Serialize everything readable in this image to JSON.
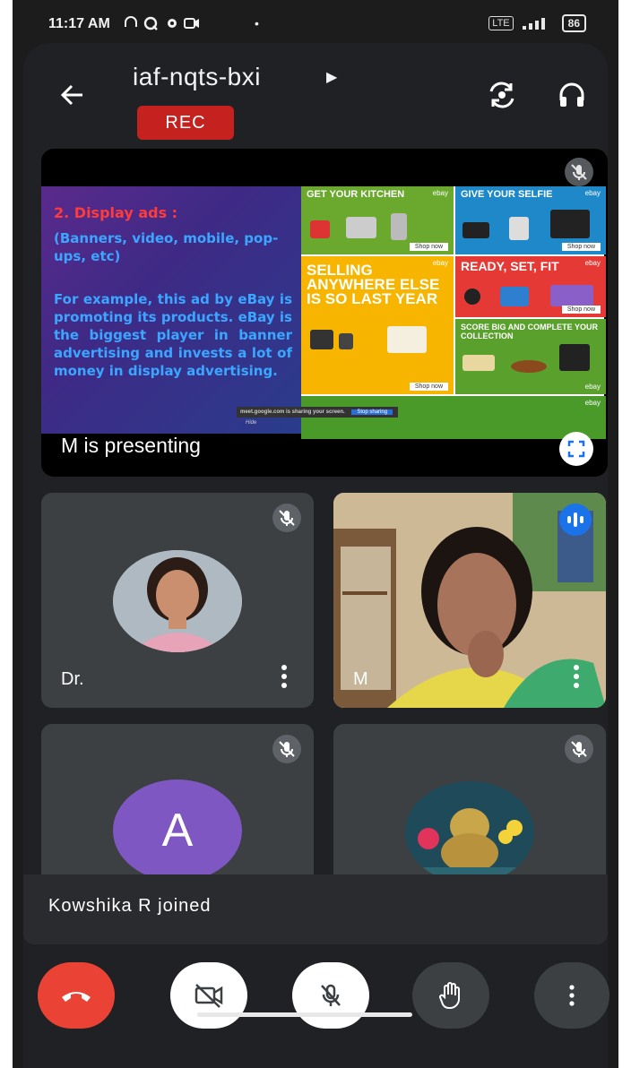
{
  "status_bar": {
    "time": "11:17 AM",
    "network": "LTE",
    "battery": "86"
  },
  "meeting": {
    "code": "iaf-nqts-bxi",
    "rec_label": "REC"
  },
  "presentation": {
    "presenter_label": "M is presenting",
    "slide": {
      "heading": "2. Display ads :",
      "subheading": "(Banners, video, mobile, pop-ups, etc)",
      "body": "For example, this ad by eBay is promoting its products. eBay is the biggest player in banner advertising and invests a lot of money in display advertising.",
      "ads": {
        "kitchen": "GET YOUR KITCHEN",
        "selfie": "GIVE YOUR SELFIE",
        "ready": "READY, SET, FIT",
        "selling": "SELLING ANYWHERE ELSE IS SO LAST YEAR",
        "score": "SCORE BIG AND COMPLETE YOUR COLLECTION",
        "brand": "ebay",
        "shop": "Shop now"
      },
      "share_bar": {
        "text": "meet.google.com is sharing your screen.",
        "stop": "Stop sharing",
        "hide": "Hide"
      }
    }
  },
  "participants": [
    {
      "name": "Dr.",
      "muted": true
    },
    {
      "name": "M",
      "muted": false,
      "speaking": true
    },
    {
      "name": "",
      "initial": "A",
      "muted": true
    },
    {
      "name": "",
      "muted": true
    }
  ],
  "toast": "Kowshika R joined",
  "colors": {
    "rec": "#c5221f",
    "end_call": "#ea4335",
    "avatar_a": "#7e57c2",
    "speaking": "#1a73e8"
  }
}
